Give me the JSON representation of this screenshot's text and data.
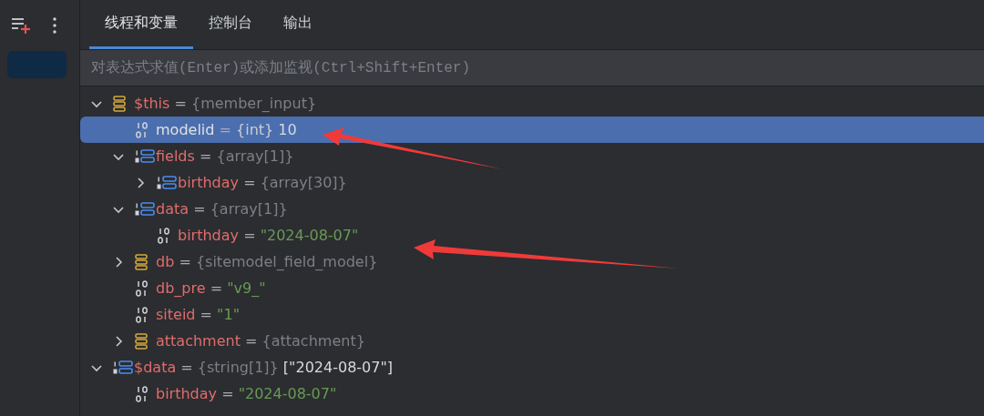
{
  "tabs": [
    {
      "label": "线程和变量",
      "selected": true
    },
    {
      "label": "控制台",
      "selected": false
    },
    {
      "label": "输出",
      "selected": false
    }
  ],
  "expression_field": {
    "placeholder": "对表达式求值(Enter)或添加监视(Ctrl+Shift+Enter)"
  },
  "tree": [
    {
      "name": "$this",
      "kind": "object",
      "expanded": true,
      "selected": false,
      "separator": "=",
      "type": "{member_input}",
      "children": [
        {
          "name": "modelid",
          "kind": "scalar",
          "selected": true,
          "separator": "=",
          "type": "{int}",
          "value": "10",
          "is_string": false
        },
        {
          "name": "fields",
          "kind": "array",
          "expanded": true,
          "selected": false,
          "separator": "=",
          "type": "{array[1]}",
          "children": [
            {
              "name": "birthday",
              "kind": "array",
              "expanded": false,
              "selected": false,
              "separator": "=",
              "type": "{array[30]}"
            }
          ]
        },
        {
          "name": "data",
          "kind": "array",
          "expanded": true,
          "selected": false,
          "separator": "=",
          "type": "{array[1]}",
          "children": [
            {
              "name": "birthday",
              "kind": "scalar",
              "selected": false,
              "separator": "=",
              "value": "\"2024-08-07\"",
              "is_string": true
            }
          ]
        },
        {
          "name": "db",
          "kind": "object",
          "expanded": false,
          "selected": false,
          "separator": "=",
          "type": "{sitemodel_field_model}"
        },
        {
          "name": "db_pre",
          "kind": "scalar",
          "selected": false,
          "separator": "=",
          "value": "\"v9_\"",
          "is_string": true
        },
        {
          "name": "siteid",
          "kind": "scalar",
          "selected": false,
          "separator": "=",
          "value": "\"1\"",
          "is_string": true
        },
        {
          "name": "attachment",
          "kind": "object",
          "expanded": false,
          "selected": false,
          "separator": "=",
          "type": "{attachment}"
        }
      ]
    },
    {
      "name": "$data",
      "kind": "array",
      "expanded": true,
      "selected": false,
      "separator": "=",
      "type": "{string[1]}",
      "value": "[\"2024-08-07\"]",
      "is_string": false,
      "children": [
        {
          "name": "birthday",
          "kind": "scalar",
          "selected": false,
          "separator": "=",
          "value": "\"2024-08-07\"",
          "is_string": true
        }
      ]
    }
  ]
}
